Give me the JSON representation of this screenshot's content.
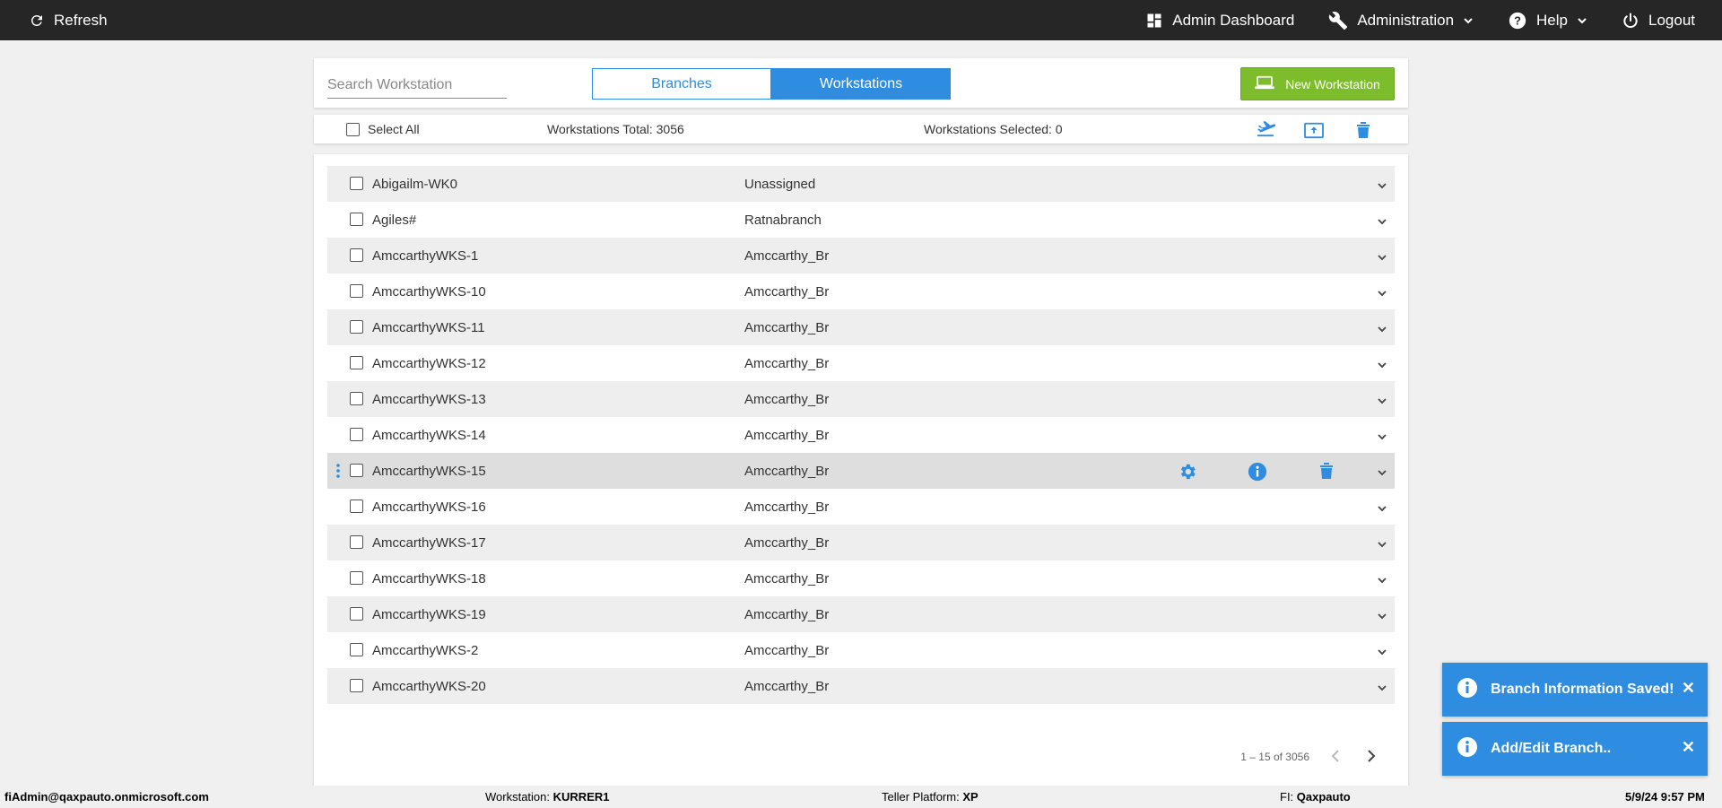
{
  "topbar": {
    "refresh_label": "Refresh",
    "admin_dashboard_label": "Admin Dashboard",
    "administration_label": "Administration",
    "help_label": "Help",
    "logout_label": "Logout"
  },
  "header": {
    "search_placeholder": "Search Workstation",
    "tabs": [
      {
        "label": "Branches",
        "active": false
      },
      {
        "label": "Workstations",
        "active": true
      }
    ],
    "new_button_label": "New Workstation"
  },
  "toolbar": {
    "select_all_label": "Select All",
    "total_label": "Workstations Total: 3056",
    "selected_label": "Workstations Selected: 0"
  },
  "rows": [
    {
      "name": "Abigailm-WK0",
      "branch": "Unassigned"
    },
    {
      "name": "Agiles#",
      "branch": "Ratnabranch"
    },
    {
      "name": "AmccarthyWKS-1",
      "branch": "Amccarthy_Br"
    },
    {
      "name": "AmccarthyWKS-10",
      "branch": "Amccarthy_Br"
    },
    {
      "name": "AmccarthyWKS-11",
      "branch": "Amccarthy_Br"
    },
    {
      "name": "AmccarthyWKS-12",
      "branch": "Amccarthy_Br"
    },
    {
      "name": "AmccarthyWKS-13",
      "branch": "Amccarthy_Br"
    },
    {
      "name": "AmccarthyWKS-14",
      "branch": "Amccarthy_Br"
    },
    {
      "name": "AmccarthyWKS-15",
      "branch": "Amccarthy_Br",
      "hovered": true
    },
    {
      "name": "AmccarthyWKS-16",
      "branch": "Amccarthy_Br"
    },
    {
      "name": "AmccarthyWKS-17",
      "branch": "Amccarthy_Br"
    },
    {
      "name": "AmccarthyWKS-18",
      "branch": "Amccarthy_Br"
    },
    {
      "name": "AmccarthyWKS-19",
      "branch": "Amccarthy_Br"
    },
    {
      "name": "AmccarthyWKS-2",
      "branch": "Amccarthy_Br"
    },
    {
      "name": "AmccarthyWKS-20",
      "branch": "Amccarthy_Br"
    }
  ],
  "pagination": {
    "label": "1 – 15 of 3056"
  },
  "toasts": [
    {
      "message": "Branch Information Saved!"
    },
    {
      "message": "Add/Edit Branch.."
    }
  ],
  "statusbar": {
    "user": "fiAdmin@qaxpauto.onmicrosoft.com",
    "workstation_label": "Workstation:",
    "workstation_value": "KURRER1",
    "platform_label": "Teller Platform:",
    "platform_value": "XP",
    "fi_label": "FI:",
    "fi_value": "Qaxpauto",
    "datetime": "5/9/24 9:57 PM"
  },
  "colors": {
    "accent": "#2e8de0",
    "topbar": "#262626",
    "new_button": "#7dbd2b",
    "row_shade": "#eeeeee"
  }
}
